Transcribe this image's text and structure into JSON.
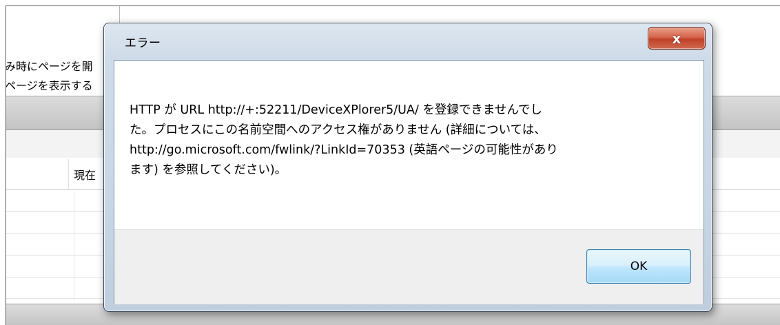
{
  "background": {
    "text_line1": "み時にページを開",
    "text_line2": "ページを表示する",
    "column_label": "現在"
  },
  "dialog": {
    "title": "エラー",
    "close_label": "x",
    "message_lines": [
      "HTTP が URL http://+:52211/DeviceXPlorer5/UA/ を登録できませんでし",
      "た。プロセスにこの名前空間へのアクセス権がありません (詳細については、",
      "http://go.microsoft.com/fwlink/?LinkId=70353 (英語ページの可能性があり",
      "ます) を参照してください)。"
    ],
    "ok_label": "OK"
  }
}
